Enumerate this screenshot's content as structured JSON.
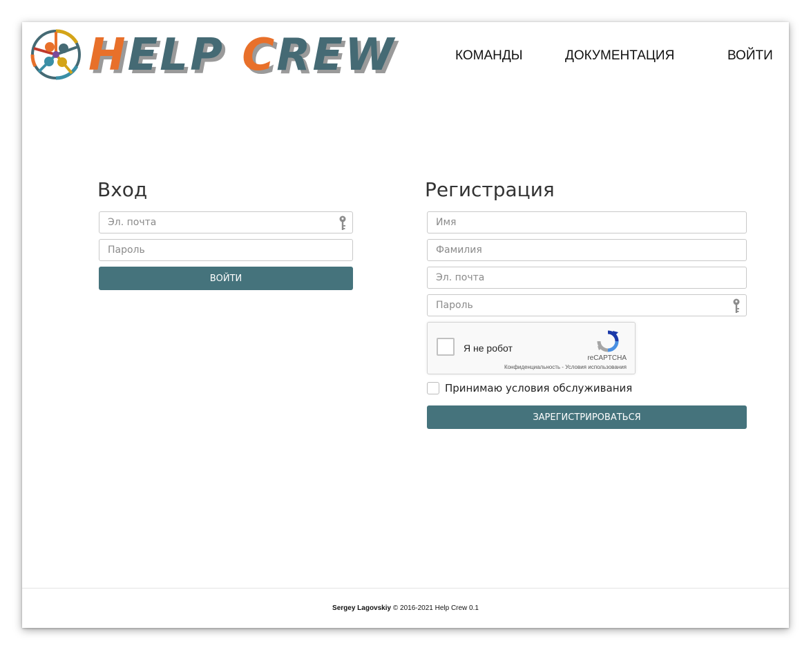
{
  "header": {
    "logo": {
      "word1_first": "H",
      "word1_rest": "ELP",
      "word2_first": "C",
      "word2_rest": "REW"
    },
    "nav": {
      "teams": "КОМАНДЫ",
      "docs": "ДОКУМЕНТАЦИЯ",
      "login": "ВОЙТИ"
    }
  },
  "login": {
    "title": "Вход",
    "email_placeholder": "Эл. почта",
    "password_placeholder": "Пароль",
    "submit": "ВОЙТИ"
  },
  "register": {
    "title": "Регистрация",
    "first_name_placeholder": "Имя",
    "last_name_placeholder": "Фамилия",
    "email_placeholder": "Эл. почта",
    "password_placeholder": "Пароль",
    "captcha": {
      "label": "Я не робот",
      "brand": "reCAPTCHA",
      "links": "Конфиденциальность - Условия использования"
    },
    "terms_label": "Принимаю условия обслуживания",
    "submit": "ЗАРЕГИСТРИРОВАТЬСЯ"
  },
  "footer": {
    "author": "Sergey Lagovskiy",
    "rest": " © 2016-2021  Help Crew 0.1"
  },
  "colors": {
    "accent": "#45737c",
    "logo_orange": "#e8702a",
    "logo_teal": "#456a74"
  }
}
